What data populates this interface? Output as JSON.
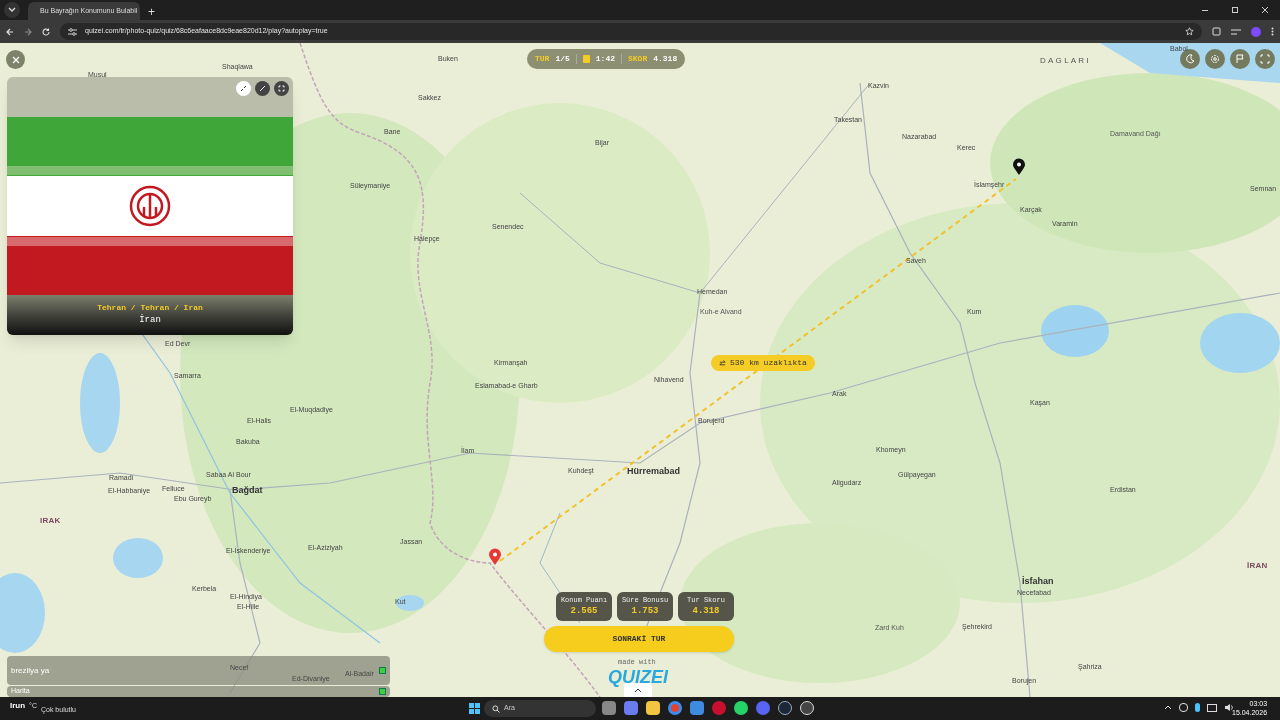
{
  "browser": {
    "tab_title": "Bu Bayrağın Konumunu Bulabil",
    "new_tab": "+",
    "url": "quizei.com/tr/photo-quiz/quiz/68c6eafaace8dc9eae820d12/play?autoplay=true"
  },
  "hud": {
    "round_label": "TUR",
    "round": "1/5",
    "time": "1:42",
    "score_label": "SKOR",
    "score": "4.318"
  },
  "flag_card": {
    "location": "Tehran / Tehran / Iran",
    "country": "İran"
  },
  "map": {
    "distance": "530 km uzaklıkta",
    "labels": [
      {
        "text": "Musul",
        "kind": "city"
      },
      {
        "text": "Shaqlawa",
        "kind": "city"
      },
      {
        "text": "Buken",
        "kind": "city"
      },
      {
        "text": "Sakkez",
        "kind": "city"
      },
      {
        "text": "Bane",
        "kind": "city"
      },
      {
        "text": "Bijar",
        "kind": "city"
      },
      {
        "text": "Süleymaniye",
        "kind": "city"
      },
      {
        "text": "Halepçe",
        "kind": "city"
      },
      {
        "text": "Senendec",
        "kind": "city"
      },
      {
        "text": "Hemedan",
        "kind": "city"
      },
      {
        "text": "Kuh-e Alvand",
        "kind": "peak"
      },
      {
        "text": "Kirmanşah",
        "kind": "city"
      },
      {
        "text": "Eslamabad-e Gharb",
        "kind": "city"
      },
      {
        "text": "Nihavend",
        "kind": "city"
      },
      {
        "text": "Borujerd",
        "kind": "city"
      },
      {
        "text": "Kuhdeşt",
        "kind": "city"
      },
      {
        "text": "Hürremabad",
        "kind": "major"
      },
      {
        "text": "İlam",
        "kind": "city"
      },
      {
        "text": "Ed Devr",
        "kind": "city"
      },
      {
        "text": "Samarra",
        "kind": "city"
      },
      {
        "text": "El-Halis",
        "kind": "city"
      },
      {
        "text": "El-Muqdadiye",
        "kind": "city"
      },
      {
        "text": "Bakuba",
        "kind": "city"
      },
      {
        "text": "Sabaa Al Bour",
        "kind": "city"
      },
      {
        "text": "Ramadi",
        "kind": "city"
      },
      {
        "text": "El-Habbaniye",
        "kind": "city"
      },
      {
        "text": "Felluce",
        "kind": "city"
      },
      {
        "text": "Ebu Gureyb",
        "kind": "city"
      },
      {
        "text": "Bağdat",
        "kind": "major"
      },
      {
        "text": "IRAK",
        "kind": "country"
      },
      {
        "text": "El-İskenderiye",
        "kind": "city"
      },
      {
        "text": "El-Aziziyah",
        "kind": "city"
      },
      {
        "text": "Jassan",
        "kind": "city"
      },
      {
        "text": "Kerbela",
        "kind": "city"
      },
      {
        "text": "El-Hindiya",
        "kind": "city"
      },
      {
        "text": "El-Hille",
        "kind": "city"
      },
      {
        "text": "Kut",
        "kind": "city"
      },
      {
        "text": "Necef",
        "kind": "city"
      },
      {
        "text": "Ed-Divaniye",
        "kind": "city"
      },
      {
        "text": "Al-Badair",
        "kind": "city"
      },
      {
        "text": "Babol",
        "kind": "city"
      },
      {
        "text": "D A G L A R I",
        "kind": "region"
      },
      {
        "text": "Kazvin",
        "kind": "city"
      },
      {
        "text": "Takestan",
        "kind": "city"
      },
      {
        "text": "Nazarabad",
        "kind": "city"
      },
      {
        "text": "Kerec",
        "kind": "city"
      },
      {
        "text": "Damavand Dağı",
        "kind": "peak"
      },
      {
        "text": "İslamşehr",
        "kind": "city"
      },
      {
        "text": "Karçak",
        "kind": "city"
      },
      {
        "text": "Varamin",
        "kind": "city"
      },
      {
        "text": "Semnan",
        "kind": "city"
      },
      {
        "text": "Saveh",
        "kind": "city"
      },
      {
        "text": "Kum",
        "kind": "city"
      },
      {
        "text": "Arak",
        "kind": "city"
      },
      {
        "text": "Kaşan",
        "kind": "city"
      },
      {
        "text": "Khomeyn",
        "kind": "city"
      },
      {
        "text": "Gülpayegan",
        "kind": "city"
      },
      {
        "text": "Aligudarz",
        "kind": "city"
      },
      {
        "text": "Erdistan",
        "kind": "city"
      },
      {
        "text": "İsfahan",
        "kind": "major"
      },
      {
        "text": "Necefabad",
        "kind": "city"
      },
      {
        "text": "Zard Kuh",
        "kind": "peak"
      },
      {
        "text": "Şehrekird",
        "kind": "city"
      },
      {
        "text": "Şahriza",
        "kind": "city"
      },
      {
        "text": "Borujen",
        "kind": "city"
      },
      {
        "text": "İRAN",
        "kind": "country"
      }
    ]
  },
  "results": [
    {
      "label": "Konum Puanı",
      "value": "2.565"
    },
    {
      "label": "Süre Bonusu",
      "value": "1.753"
    },
    {
      "label": "Tur Skoru",
      "value": "4.318"
    }
  ],
  "next_button": "SONRAKİ TUR",
  "branding": {
    "made_with": "made with",
    "logo": "QUIZEI"
  },
  "chat": [
    {
      "text": "brezilya ya"
    },
    {
      "text": "Harita"
    }
  ],
  "taskbar": {
    "weather_city": "Irun",
    "weather_unit": "°C",
    "weather_desc": "Çok bulutlu",
    "search_placeholder": "Ara",
    "time": "03:03",
    "date": "15.04.2026"
  }
}
